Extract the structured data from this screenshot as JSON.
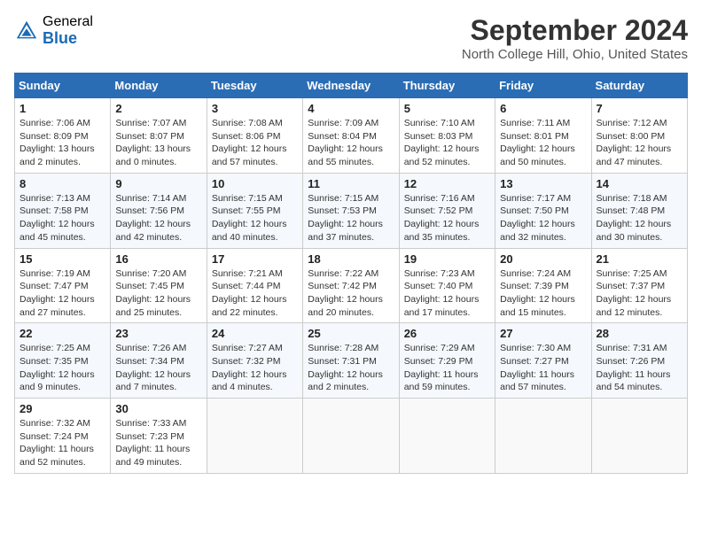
{
  "header": {
    "logo_general": "General",
    "logo_blue": "Blue",
    "title": "September 2024",
    "location": "North College Hill, Ohio, United States"
  },
  "days_of_week": [
    "Sunday",
    "Monday",
    "Tuesday",
    "Wednesday",
    "Thursday",
    "Friday",
    "Saturday"
  ],
  "weeks": [
    [
      {
        "day": "1",
        "sunrise": "Sunrise: 7:06 AM",
        "sunset": "Sunset: 8:09 PM",
        "daylight": "Daylight: 13 hours and 2 minutes."
      },
      {
        "day": "2",
        "sunrise": "Sunrise: 7:07 AM",
        "sunset": "Sunset: 8:07 PM",
        "daylight": "Daylight: 13 hours and 0 minutes."
      },
      {
        "day": "3",
        "sunrise": "Sunrise: 7:08 AM",
        "sunset": "Sunset: 8:06 PM",
        "daylight": "Daylight: 12 hours and 57 minutes."
      },
      {
        "day": "4",
        "sunrise": "Sunrise: 7:09 AM",
        "sunset": "Sunset: 8:04 PM",
        "daylight": "Daylight: 12 hours and 55 minutes."
      },
      {
        "day": "5",
        "sunrise": "Sunrise: 7:10 AM",
        "sunset": "Sunset: 8:03 PM",
        "daylight": "Daylight: 12 hours and 52 minutes."
      },
      {
        "day": "6",
        "sunrise": "Sunrise: 7:11 AM",
        "sunset": "Sunset: 8:01 PM",
        "daylight": "Daylight: 12 hours and 50 minutes."
      },
      {
        "day": "7",
        "sunrise": "Sunrise: 7:12 AM",
        "sunset": "Sunset: 8:00 PM",
        "daylight": "Daylight: 12 hours and 47 minutes."
      }
    ],
    [
      {
        "day": "8",
        "sunrise": "Sunrise: 7:13 AM",
        "sunset": "Sunset: 7:58 PM",
        "daylight": "Daylight: 12 hours and 45 minutes."
      },
      {
        "day": "9",
        "sunrise": "Sunrise: 7:14 AM",
        "sunset": "Sunset: 7:56 PM",
        "daylight": "Daylight: 12 hours and 42 minutes."
      },
      {
        "day": "10",
        "sunrise": "Sunrise: 7:15 AM",
        "sunset": "Sunset: 7:55 PM",
        "daylight": "Daylight: 12 hours and 40 minutes."
      },
      {
        "day": "11",
        "sunrise": "Sunrise: 7:15 AM",
        "sunset": "Sunset: 7:53 PM",
        "daylight": "Daylight: 12 hours and 37 minutes."
      },
      {
        "day": "12",
        "sunrise": "Sunrise: 7:16 AM",
        "sunset": "Sunset: 7:52 PM",
        "daylight": "Daylight: 12 hours and 35 minutes."
      },
      {
        "day": "13",
        "sunrise": "Sunrise: 7:17 AM",
        "sunset": "Sunset: 7:50 PM",
        "daylight": "Daylight: 12 hours and 32 minutes."
      },
      {
        "day": "14",
        "sunrise": "Sunrise: 7:18 AM",
        "sunset": "Sunset: 7:48 PM",
        "daylight": "Daylight: 12 hours and 30 minutes."
      }
    ],
    [
      {
        "day": "15",
        "sunrise": "Sunrise: 7:19 AM",
        "sunset": "Sunset: 7:47 PM",
        "daylight": "Daylight: 12 hours and 27 minutes."
      },
      {
        "day": "16",
        "sunrise": "Sunrise: 7:20 AM",
        "sunset": "Sunset: 7:45 PM",
        "daylight": "Daylight: 12 hours and 25 minutes."
      },
      {
        "day": "17",
        "sunrise": "Sunrise: 7:21 AM",
        "sunset": "Sunset: 7:44 PM",
        "daylight": "Daylight: 12 hours and 22 minutes."
      },
      {
        "day": "18",
        "sunrise": "Sunrise: 7:22 AM",
        "sunset": "Sunset: 7:42 PM",
        "daylight": "Daylight: 12 hours and 20 minutes."
      },
      {
        "day": "19",
        "sunrise": "Sunrise: 7:23 AM",
        "sunset": "Sunset: 7:40 PM",
        "daylight": "Daylight: 12 hours and 17 minutes."
      },
      {
        "day": "20",
        "sunrise": "Sunrise: 7:24 AM",
        "sunset": "Sunset: 7:39 PM",
        "daylight": "Daylight: 12 hours and 15 minutes."
      },
      {
        "day": "21",
        "sunrise": "Sunrise: 7:25 AM",
        "sunset": "Sunset: 7:37 PM",
        "daylight": "Daylight: 12 hours and 12 minutes."
      }
    ],
    [
      {
        "day": "22",
        "sunrise": "Sunrise: 7:25 AM",
        "sunset": "Sunset: 7:35 PM",
        "daylight": "Daylight: 12 hours and 9 minutes."
      },
      {
        "day": "23",
        "sunrise": "Sunrise: 7:26 AM",
        "sunset": "Sunset: 7:34 PM",
        "daylight": "Daylight: 12 hours and 7 minutes."
      },
      {
        "day": "24",
        "sunrise": "Sunrise: 7:27 AM",
        "sunset": "Sunset: 7:32 PM",
        "daylight": "Daylight: 12 hours and 4 minutes."
      },
      {
        "day": "25",
        "sunrise": "Sunrise: 7:28 AM",
        "sunset": "Sunset: 7:31 PM",
        "daylight": "Daylight: 12 hours and 2 minutes."
      },
      {
        "day": "26",
        "sunrise": "Sunrise: 7:29 AM",
        "sunset": "Sunset: 7:29 PM",
        "daylight": "Daylight: 11 hours and 59 minutes."
      },
      {
        "day": "27",
        "sunrise": "Sunrise: 7:30 AM",
        "sunset": "Sunset: 7:27 PM",
        "daylight": "Daylight: 11 hours and 57 minutes."
      },
      {
        "day": "28",
        "sunrise": "Sunrise: 7:31 AM",
        "sunset": "Sunset: 7:26 PM",
        "daylight": "Daylight: 11 hours and 54 minutes."
      }
    ],
    [
      {
        "day": "29",
        "sunrise": "Sunrise: 7:32 AM",
        "sunset": "Sunset: 7:24 PM",
        "daylight": "Daylight: 11 hours and 52 minutes."
      },
      {
        "day": "30",
        "sunrise": "Sunrise: 7:33 AM",
        "sunset": "Sunset: 7:23 PM",
        "daylight": "Daylight: 11 hours and 49 minutes."
      },
      null,
      null,
      null,
      null,
      null
    ]
  ]
}
